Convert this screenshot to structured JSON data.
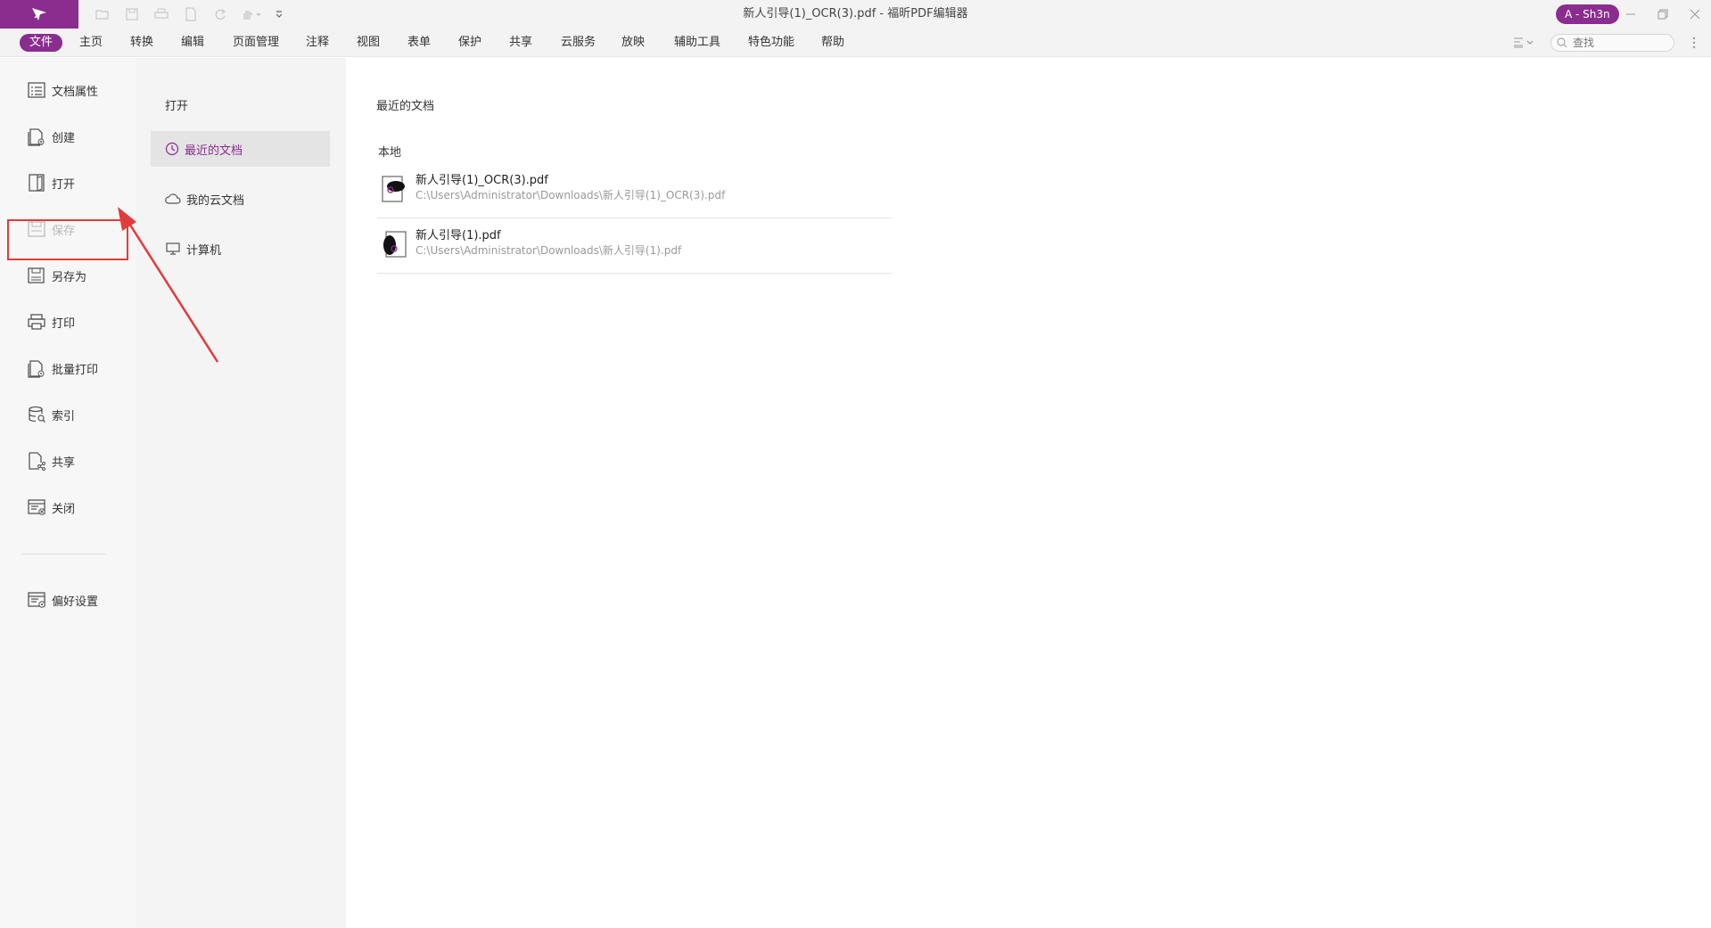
{
  "titlebar": {
    "title": "新人引导(1)_OCR(3).pdf - 福昕PDF编辑器",
    "user": "A - Sh3n",
    "quick_access_icons": [
      "open-icon",
      "save-icon",
      "print-icon",
      "new-icon",
      "redo-icon",
      "hand-tool-icon",
      "customize-icon"
    ]
  },
  "menubar": {
    "items": [
      "文件",
      "主页",
      "转换",
      "编辑",
      "页面管理",
      "注释",
      "视图",
      "表单",
      "保护",
      "共享",
      "云服务",
      "放映",
      "辅助工具",
      "特色功能",
      "帮助"
    ],
    "active": "文件",
    "search_placeholder": "查找"
  },
  "left_panel": {
    "items": [
      {
        "label": "文档属性",
        "icon": "document-properties-icon"
      },
      {
        "label": "创建",
        "icon": "create-icon"
      },
      {
        "label": "打开",
        "icon": "open-book-icon",
        "selected": true
      },
      {
        "label": "保存",
        "icon": "save-icon",
        "disabled": true
      },
      {
        "label": "另存为",
        "icon": "save-as-icon"
      },
      {
        "label": "打印",
        "icon": "printer-icon"
      },
      {
        "label": "批量打印",
        "icon": "batch-print-icon"
      },
      {
        "label": "索引",
        "icon": "index-icon"
      },
      {
        "label": "共享",
        "icon": "share-icon"
      },
      {
        "label": "关闭",
        "icon": "close-document-icon"
      }
    ],
    "preferences": {
      "label": "偏好设置",
      "icon": "preferences-icon"
    }
  },
  "mid_panel": {
    "title": "打开",
    "items": [
      {
        "label": "最近的文档",
        "icon": "clock-icon",
        "active": true
      },
      {
        "label": "我的云文档",
        "icon": "cloud-icon"
      },
      {
        "label": "计算机",
        "icon": "computer-icon"
      }
    ]
  },
  "content": {
    "title": "最近的文档",
    "section": "本地",
    "files": [
      {
        "name": "新人引导(1)_OCR(3).pdf",
        "path": "C:\\Users\\Administrator\\Downloads\\新人引导(1)_OCR(3).pdf"
      },
      {
        "name": "新人引导(1).pdf",
        "path": "C:\\Users\\Administrator\\Downloads\\新人引导(1).pdf"
      }
    ]
  },
  "colors": {
    "accent": "#8a2d8f",
    "highlight": "#e23b3b"
  }
}
